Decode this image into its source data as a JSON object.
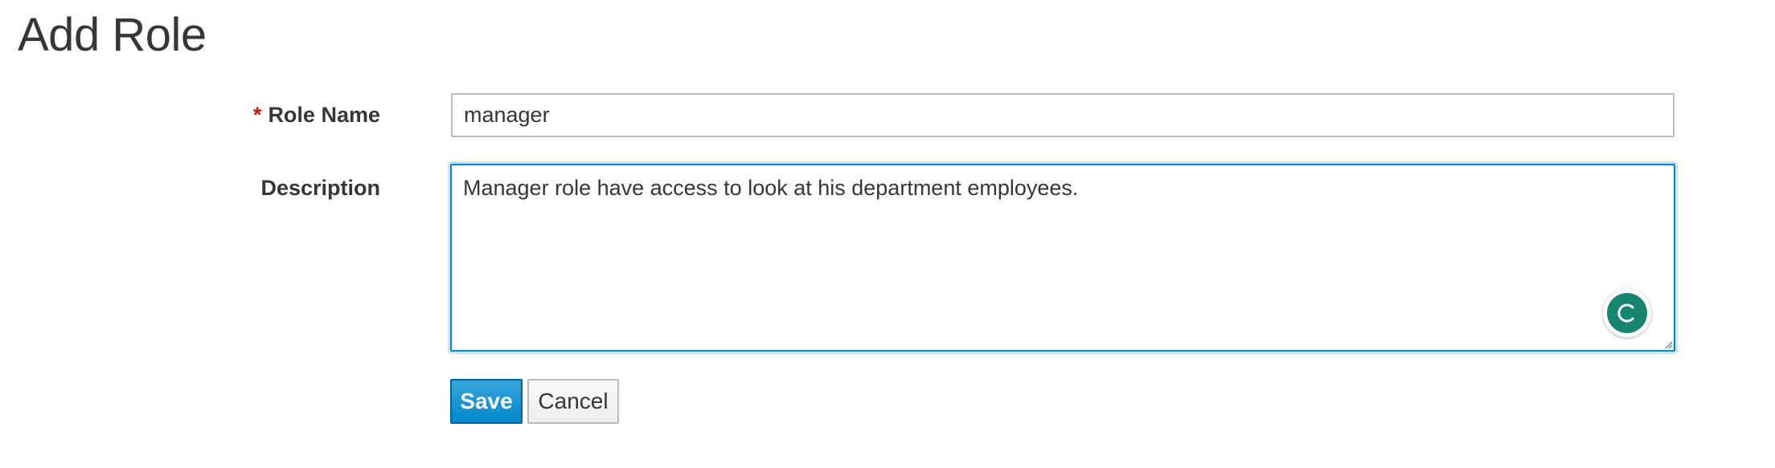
{
  "page": {
    "title": "Add Role"
  },
  "form": {
    "role_name": {
      "required_marker": "*",
      "label": "Role Name",
      "value": "manager"
    },
    "description": {
      "label": "Description",
      "value": "Manager role have access to look at his department employees."
    },
    "save_label": "Save",
    "cancel_label": "Cancel"
  },
  "icons": {
    "grammar_badge": "grammar-assistant-icon",
    "resize": "resize-handle-icon"
  },
  "colors": {
    "accent": "#0088ce",
    "required": "#c9190b",
    "badge": "#15856f"
  }
}
